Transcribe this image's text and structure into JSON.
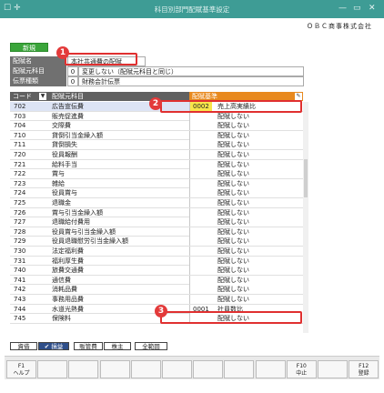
{
  "window": {
    "title": "科目別部門配賦基準設定",
    "min": "—",
    "restore": "▭",
    "close": "✕"
  },
  "company": "ＯＢＣ商事株式会社",
  "new_button": "新規",
  "fields": [
    {
      "label": "配賦名",
      "code": "",
      "value": "本社共通費の配賦"
    },
    {
      "label": "配賦元科目",
      "code": "0",
      "value": "変更しない（配賦元科目と同じ）"
    },
    {
      "label": "伝票種類",
      "code": "0",
      "value": "財務会計伝票"
    }
  ],
  "grid": {
    "col_code": "コード",
    "col_name": "配賦元科目",
    "col_std": "配賦基準",
    "rows": [
      {
        "code": "702",
        "name": "広告宣伝費",
        "std_code": "0002",
        "std": "売上高実績比"
      },
      {
        "code": "703",
        "name": "販売促進費",
        "std_code": "",
        "std": "配賦しない"
      },
      {
        "code": "704",
        "name": "交際費",
        "std_code": "",
        "std": "配賦しない"
      },
      {
        "code": "710",
        "name": "貸倒引当金繰入額",
        "std_code": "",
        "std": "配賦しない"
      },
      {
        "code": "711",
        "name": "貸倒損失",
        "std_code": "",
        "std": "配賦しない"
      },
      {
        "code": "720",
        "name": "役員報酬",
        "std_code": "",
        "std": "配賦しない"
      },
      {
        "code": "721",
        "name": "給料手当",
        "std_code": "",
        "std": "配賦しない"
      },
      {
        "code": "722",
        "name": "賞与",
        "std_code": "",
        "std": "配賦しない"
      },
      {
        "code": "723",
        "name": "雑給",
        "std_code": "",
        "std": "配賦しない"
      },
      {
        "code": "724",
        "name": "役員賞与",
        "std_code": "",
        "std": "配賦しない"
      },
      {
        "code": "725",
        "name": "退職金",
        "std_code": "",
        "std": "配賦しない"
      },
      {
        "code": "726",
        "name": "賞与引当金繰入額",
        "std_code": "",
        "std": "配賦しない"
      },
      {
        "code": "727",
        "name": "退職給付費用",
        "std_code": "",
        "std": "配賦しない"
      },
      {
        "code": "728",
        "name": "役員賞与引当金繰入額",
        "std_code": "",
        "std": "配賦しない"
      },
      {
        "code": "729",
        "name": "役員退職慰労引当金繰入額",
        "std_code": "",
        "std": "配賦しない"
      },
      {
        "code": "730",
        "name": "法定福利費",
        "std_code": "",
        "std": "配賦しない"
      },
      {
        "code": "731",
        "name": "福利厚生費",
        "std_code": "",
        "std": "配賦しない"
      },
      {
        "code": "740",
        "name": "旅費交通費",
        "std_code": "",
        "std": "配賦しない"
      },
      {
        "code": "741",
        "name": "通信費",
        "std_code": "",
        "std": "配賦しない"
      },
      {
        "code": "742",
        "name": "消耗品費",
        "std_code": "",
        "std": "配賦しない"
      },
      {
        "code": "743",
        "name": "事務用品費",
        "std_code": "",
        "std": "配賦しない"
      },
      {
        "code": "744",
        "name": "水道光熱費",
        "std_code": "0001",
        "std": "社員数比"
      },
      {
        "code": "745",
        "name": "保険料",
        "std_code": "",
        "std": "配賦しない"
      }
    ]
  },
  "tabs": [
    {
      "label": "資借",
      "active": false
    },
    {
      "label": "✔ 損益",
      "active": true
    },
    {
      "label": "販管費",
      "active": false
    },
    {
      "label": "株主",
      "active": false
    },
    {
      "label": "全範囲",
      "active": false
    }
  ],
  "fkeys": [
    {
      "k": "F1",
      "l": "ヘルプ"
    },
    {
      "k": "",
      "l": ""
    },
    {
      "k": "",
      "l": ""
    },
    {
      "k": "",
      "l": ""
    },
    {
      "k": "",
      "l": ""
    },
    {
      "k": "",
      "l": ""
    },
    {
      "k": "",
      "l": ""
    },
    {
      "k": "",
      "l": ""
    },
    {
      "k": "",
      "l": ""
    },
    {
      "k": "F10",
      "l": "中止"
    },
    {
      "k": "",
      "l": ""
    },
    {
      "k": "F12",
      "l": "登録"
    }
  ],
  "badges": [
    "1",
    "2",
    "3"
  ],
  "colors": {
    "titlebar": "#3e9c95",
    "header": "#606060",
    "std_header": "#e8891e",
    "selected": "#dde4f5",
    "new": "#3aa53a",
    "highlight": "#e03030",
    "code_hl": "#f8e64a"
  }
}
